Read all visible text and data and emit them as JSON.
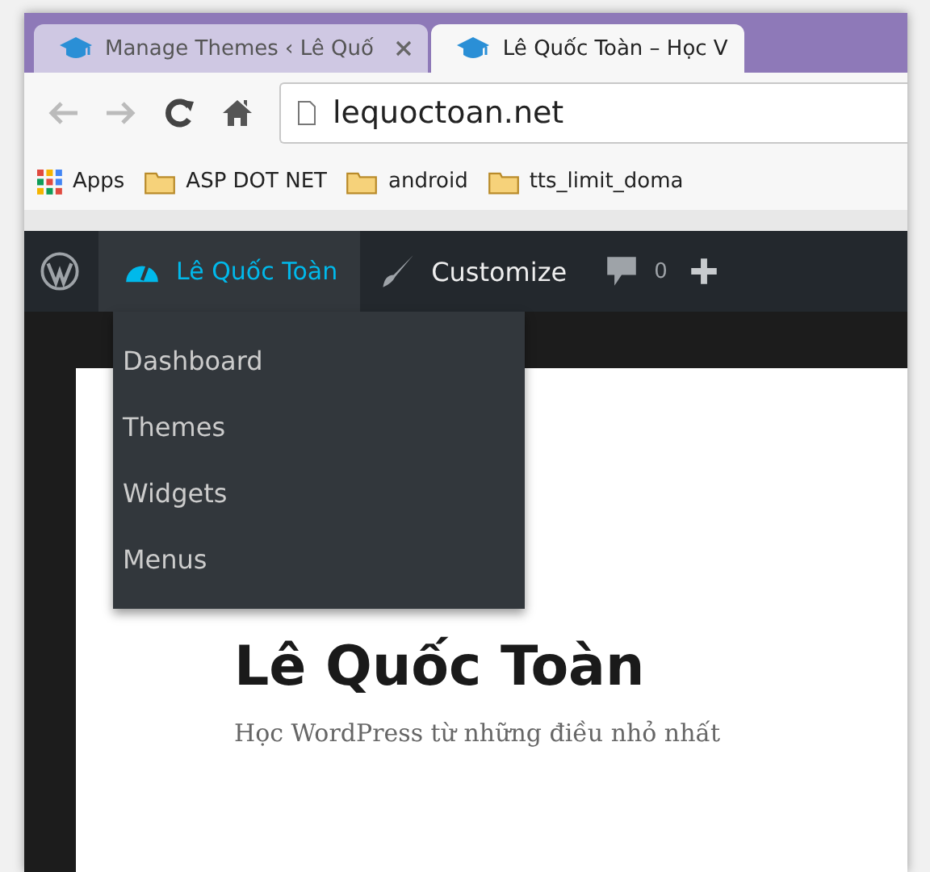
{
  "browser": {
    "tabs": [
      {
        "title": "Manage Themes ‹ Lê Quố",
        "selected": false,
        "closable": true
      },
      {
        "title": "Lê Quốc Toàn – Học V",
        "selected": true,
        "closable": false
      }
    ],
    "address": "lequoctoan.net",
    "bookmarks": [
      {
        "kind": "apps",
        "label": "Apps"
      },
      {
        "kind": "folder",
        "label": "ASP DOT NET"
      },
      {
        "kind": "folder",
        "label": "android"
      },
      {
        "kind": "folder",
        "label": "tts_limit_doma"
      }
    ]
  },
  "admin_bar": {
    "site_name": "Lê Quốc Toàn",
    "expanded": true,
    "customize": "Customize",
    "comments": "0",
    "menu": [
      "Dashboard",
      "Themes",
      "Widgets",
      "Menus"
    ]
  },
  "site": {
    "title": "Lê Quốc Toàn",
    "tagline": "Học WordPress từ những điều nhỏ nhất"
  }
}
